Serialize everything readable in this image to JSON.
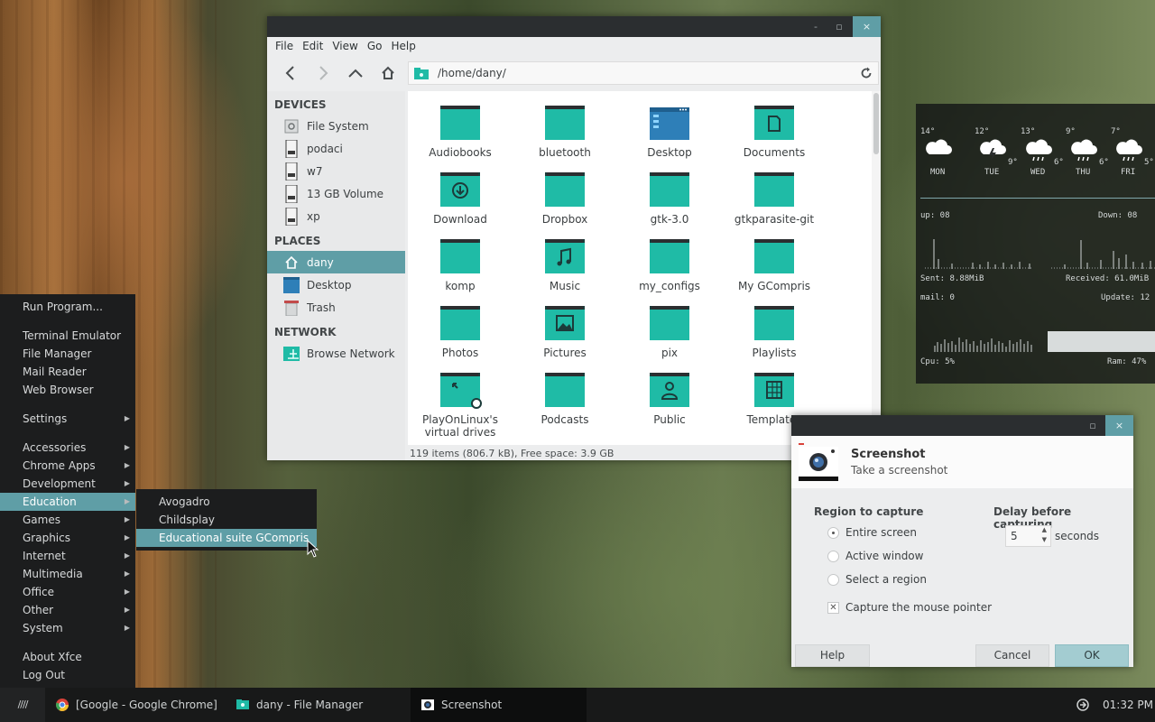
{
  "file_manager": {
    "menu": [
      "File",
      "Edit",
      "View",
      "Go",
      "Help"
    ],
    "path": "/home/dany/",
    "sections": {
      "devices": "DEVICES",
      "places": "PLACES",
      "network": "NETWORK"
    },
    "devices": [
      "File System",
      "podaci",
      "w7",
      "13 GB Volume",
      "xp"
    ],
    "places": [
      "dany",
      "Desktop",
      "Trash"
    ],
    "network": [
      "Browse Network"
    ],
    "items": [
      {
        "label": "Audiobooks",
        "icon": "folder-icon"
      },
      {
        "label": "bluetooth",
        "icon": "folder-icon"
      },
      {
        "label": "Desktop",
        "icon": "desktop-folder-icon"
      },
      {
        "label": "Documents",
        "icon": "documents-folder-icon"
      },
      {
        "label": "Download",
        "icon": "download-folder-icon"
      },
      {
        "label": "Dropbox",
        "icon": "folder-icon"
      },
      {
        "label": "gtk-3.0",
        "icon": "folder-icon"
      },
      {
        "label": "gtkparasite-git",
        "icon": "folder-icon"
      },
      {
        "label": "komp",
        "icon": "folder-icon"
      },
      {
        "label": "Music",
        "icon": "music-folder-icon"
      },
      {
        "label": "my_configs",
        "icon": "folder-icon"
      },
      {
        "label": "My GCompris",
        "icon": "folder-icon"
      },
      {
        "label": "Photos",
        "icon": "folder-icon"
      },
      {
        "label": "Pictures",
        "icon": "pictures-folder-icon"
      },
      {
        "label": "pix",
        "icon": "folder-icon"
      },
      {
        "label": "Playlists",
        "icon": "folder-icon"
      },
      {
        "label": "PlayOnLinux's virtual drives",
        "icon": "link-folder-icon"
      },
      {
        "label": "Podcasts",
        "icon": "folder-icon"
      },
      {
        "label": "Public",
        "icon": "public-folder-icon"
      },
      {
        "label": "Templates",
        "icon": "templates-folder-icon"
      }
    ],
    "status": "119 items (806.7 kB), Free space: 3.9 GB",
    "title_buttons": {
      "minimize": "-",
      "maximize": "▫",
      "close": "×"
    }
  },
  "conky": {
    "weather": [
      {
        "high": "14°",
        "low": "",
        "day": "MON",
        "icon": "cloud-icon"
      },
      {
        "high": "12°",
        "low": "9°",
        "day": "TUE",
        "icon": "storm-icon"
      },
      {
        "high": "13°",
        "low": "6°",
        "day": "WED",
        "icon": "rain-icon"
      },
      {
        "high": "9°",
        "low": "6°",
        "day": "THU",
        "icon": "rain-icon"
      },
      {
        "high": "7°",
        "low": "5°",
        "day": "FRI",
        "icon": "rain-icon"
      }
    ],
    "up": "up: 08",
    "down": "Down: 08",
    "sent": "Sent: 8.88MiB",
    "received": "Received: 61.0MiB",
    "mail": "mail: 0",
    "update": "Update: 12",
    "cpu": "Cpu: 5%",
    "ram": "Ram: 47%"
  },
  "screenshot_dialog": {
    "title": "Screenshot",
    "subtitle": "Take a screenshot",
    "region_heading": "Region to capture",
    "regions": [
      "Entire screen",
      "Active window",
      "Select a region"
    ],
    "selected_region": "Entire screen",
    "capture_pointer": "Capture the mouse pointer",
    "capture_pointer_checked": true,
    "delay_heading": "Delay before capturing",
    "delay_value": "5",
    "delay_unit": "seconds",
    "help": "Help",
    "cancel": "Cancel",
    "ok": "OK"
  },
  "app_menu": {
    "items": [
      {
        "label": "Run Program...",
        "submenu": false
      },
      {
        "label": "Terminal Emulator",
        "submenu": false
      },
      {
        "label": "File Manager",
        "submenu": false
      },
      {
        "label": "Mail Reader",
        "submenu": false
      },
      {
        "label": "Web Browser",
        "submenu": false
      },
      {
        "label": "Settings",
        "submenu": true
      },
      {
        "label": "Accessories",
        "submenu": true
      },
      {
        "label": "Chrome Apps",
        "submenu": true
      },
      {
        "label": "Development",
        "submenu": true
      },
      {
        "label": "Education",
        "submenu": true
      },
      {
        "label": "Games",
        "submenu": true
      },
      {
        "label": "Graphics",
        "submenu": true
      },
      {
        "label": "Internet",
        "submenu": true
      },
      {
        "label": "Multimedia",
        "submenu": true
      },
      {
        "label": "Office",
        "submenu": true
      },
      {
        "label": "Other",
        "submenu": true
      },
      {
        "label": "System",
        "submenu": true
      },
      {
        "label": "About Xfce",
        "submenu": false
      },
      {
        "label": "Log Out",
        "submenu": false
      }
    ],
    "selected": "Education",
    "education_submenu": [
      "Avogadro",
      "Childsplay",
      "Educational suite GCompris"
    ],
    "submenu_selected": "Educational suite GCompris"
  },
  "taskbar": {
    "menu_button": "////",
    "tasks": [
      {
        "label": "[Google - Google Chrome]",
        "icon": "chrome-icon"
      },
      {
        "label": "dany - File Manager",
        "icon": "file-manager-icon"
      },
      {
        "label": "Screenshot",
        "icon": "screenshot-icon"
      }
    ],
    "clock": "01:32 PM"
  },
  "colors": {
    "accent": "#5f9ea6",
    "folder": "#1fbba6",
    "panel": "#181919",
    "titlebar": "#2b2e30"
  }
}
